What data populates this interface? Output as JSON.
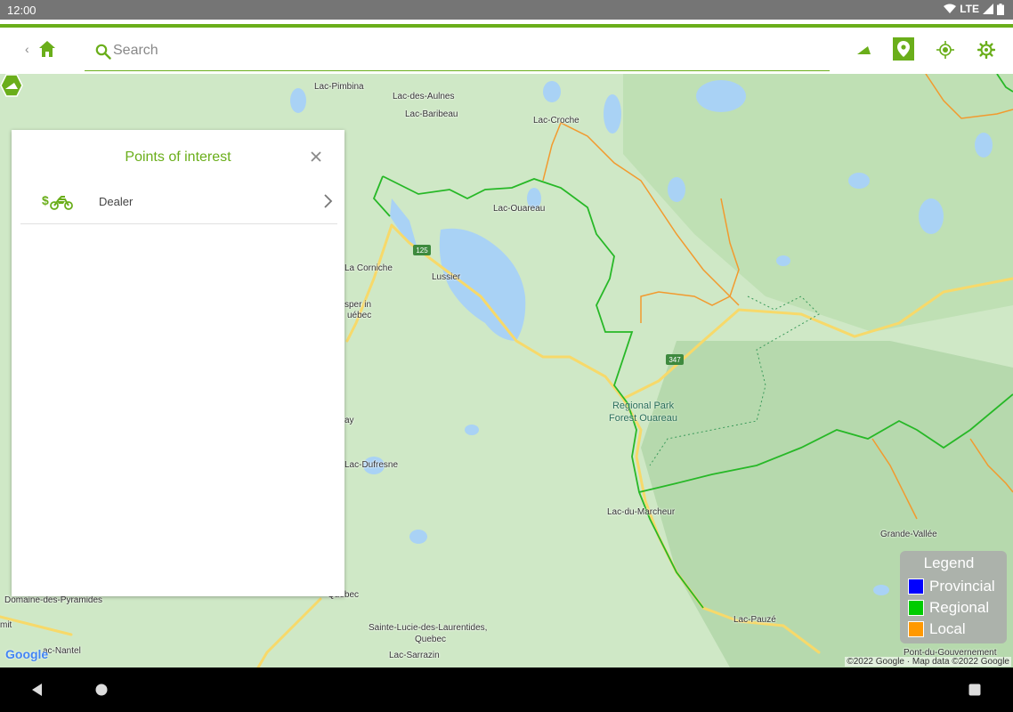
{
  "status_bar": {
    "time": "12:00",
    "network": "LTE"
  },
  "app_bar": {
    "search": {
      "placeholder": "Search",
      "value": ""
    },
    "icons": [
      "home-icon",
      "search-icon",
      "triangle-icon",
      "map-pin-icon",
      "locate-icon",
      "settings-icon"
    ],
    "accent_color": "#6aae1a"
  },
  "poi_panel": {
    "title": "Points of interest",
    "items": [
      {
        "label": "Dealer",
        "icon": "dealer-motorcycle-icon"
      }
    ]
  },
  "map": {
    "places": [
      "Lac-Pimbina",
      "Lac-des-Aulnes",
      "Lac-Baribeau",
      "Lac-Croche",
      "Lac-Ouareau",
      "La Corniche",
      "Lussier",
      "sper in",
      "uébec",
      "ay",
      "Lac-Dufresne",
      "Lac-du-Marcheur",
      "Grande-Vallée",
      "Domaine-des-Pyramides",
      "mit",
      "Sainte-Lucie-des-Laurentides,",
      "Quebec",
      "Lac-Pauzé",
      "ac-Nantel",
      "Lac-Sarrazin",
      "Pont-du-Gouvernement",
      "Quebec"
    ],
    "route_shields": [
      "125",
      "347"
    ],
    "park_label_1": "Regional Park",
    "park_label_2": "Forest Ouareau",
    "google_logo": "Google",
    "attribution": "©2022 Google · Map data ©2022 Google"
  },
  "legend": {
    "title": "Legend",
    "items": [
      {
        "label": "Provincial",
        "color": "#0000ff"
      },
      {
        "label": "Regional",
        "color": "#00cc00"
      },
      {
        "label": "Local",
        "color": "#ff9900"
      }
    ]
  }
}
